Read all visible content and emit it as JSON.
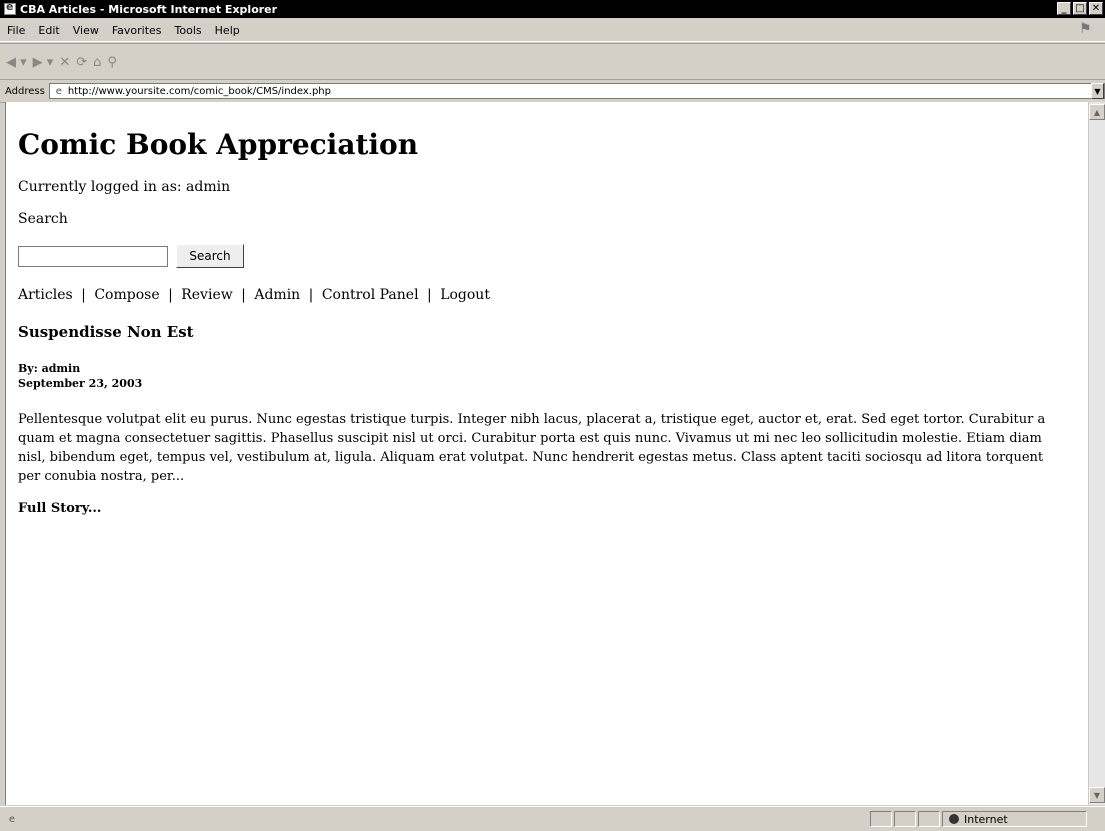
{
  "window": {
    "title": "CBA Articles - Microsoft Internet Explorer",
    "controls": [
      "minimize",
      "maximize",
      "close"
    ]
  },
  "menu": {
    "items": [
      "File",
      "Edit",
      "View",
      "Favorites",
      "Tools",
      "Help"
    ]
  },
  "toolbar": {
    "buttons": [
      "back-icon",
      "forward-icon",
      "stop-icon",
      "refresh-icon",
      "home-icon",
      "search-icon"
    ]
  },
  "address": {
    "label": "Address",
    "url": "http://www.yoursite.com/comic_book/CMS/index.php"
  },
  "page": {
    "heading": "Comic Book Appreciation",
    "logged_in": "Currently logged in as: admin",
    "search_label": "Search",
    "search_input_value": "",
    "search_button": "Search",
    "nav": [
      "Articles",
      "Compose",
      "Review",
      "Admin",
      "Control Panel",
      "Logout"
    ],
    "nav_separator": "|",
    "article": {
      "title": "Suspendisse Non Est",
      "byline": "By: admin",
      "date": "September 23, 2003",
      "body": "Pellentesque volutpat elit eu purus. Nunc egestas tristique turpis. Integer nibh lacus, placerat a, tristique eget, auctor et, erat. Sed eget tortor. Curabitur a quam et magna consectetuer sagittis. Phasellus suscipit nisl ut orci. Curabitur porta est quis nunc. Vivamus ut mi nec leo sollicitudin molestie. Etiam diam nisl, bibendum eget, tempus vel, vestibulum at, ligula. Aliquam erat volutpat. Nunc hendrerit egestas metus. Class aptent taciti sociosqu ad litora torquent per conubia nostra, per...",
      "full_story": "Full Story..."
    }
  },
  "status": {
    "zone": "Internet"
  }
}
